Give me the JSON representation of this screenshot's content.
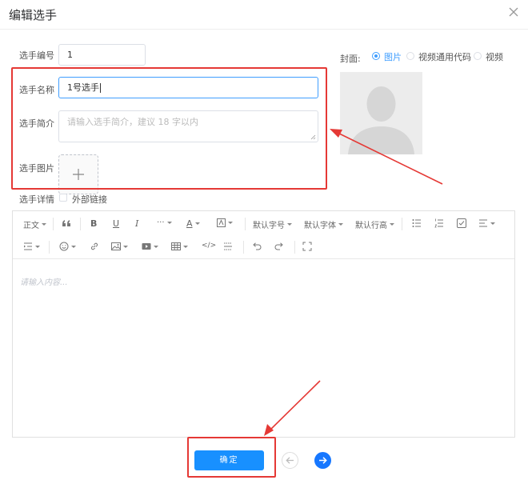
{
  "dialog": {
    "title": "编辑选手"
  },
  "form": {
    "number": {
      "label": "选手编号",
      "value": "1"
    },
    "name": {
      "label": "选手名称",
      "value": "1号选手"
    },
    "intro": {
      "label": "选手简介",
      "placeholder": "请输入选手简介，建议 18 字以内"
    },
    "image": {
      "label": "选手图片"
    },
    "details": {
      "label": "选手详情",
      "external_link_label": "外部链接",
      "external_link_checked": false
    }
  },
  "cover": {
    "label": "封面:",
    "options": [
      {
        "label": "图片",
        "selected": true
      },
      {
        "label": "视频通用代码",
        "selected": false
      },
      {
        "label": "视频",
        "selected": false
      }
    ]
  },
  "editor": {
    "toolbar": {
      "paragraph": "正文",
      "font_size": "默认字号",
      "font_family": "默认字体",
      "line_height": "默认行高"
    },
    "placeholder": "请输入内容..."
  },
  "footer": {
    "confirm_label": "确定"
  },
  "colors": {
    "accent": "#409eff",
    "primary_button": "#1890ff",
    "annotation": "#e53935"
  }
}
